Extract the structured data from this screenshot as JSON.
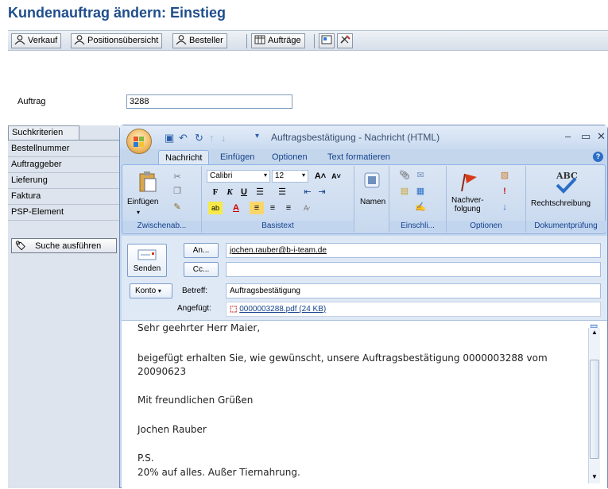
{
  "sap": {
    "title": "Kundenauftrag ändern: Einstieg",
    "toolbar": {
      "verkauf": "Verkauf",
      "positionsuebersicht": "Positionsübersicht",
      "besteller": "Besteller",
      "auftraege": "Aufträge"
    },
    "auftrag_label": "Auftrag",
    "auftrag_value": "3288",
    "left_panel": {
      "tab": "Suchkriterien",
      "items": [
        "Bestellnummer",
        "Auftraggeber",
        "Lieferung",
        "Faktura",
        "PSP-Element"
      ],
      "search_button": "Suche ausführen"
    }
  },
  "outlook": {
    "title": "Auftragsbestätigung - Nachricht (HTML)",
    "tabs": [
      "Nachricht",
      "Einfügen",
      "Optionen",
      "Text formatieren"
    ],
    "ribbon": {
      "einfuegen": "Einfügen",
      "font": "Calibri",
      "size": "12",
      "namen": "Namen",
      "nachverfolgung": "Nachver-\nfolgung",
      "rechtschreibung": "Rechtschreibung",
      "groups": [
        "Zwischenab...",
        "Basistext",
        "Einschli...",
        "Optionen",
        "Dokumentprüfung"
      ]
    },
    "header": {
      "senden": "Senden",
      "an_btn": "An...",
      "cc_btn": "Cc...",
      "to_value": "jochen.rauber@b-i-team.de",
      "cc_value": "",
      "konto": "Konto",
      "betreff_label": "Betreff:",
      "betreff_value": "Auftragsbestätigung",
      "angefuegt_label": "Angefügt:",
      "attachment": "0000003288.pdf (24 KB)"
    },
    "body": [
      "Sehr geehrter Herr Maier,",
      "beigefügt erhalten Sie, wie gewünscht, unsere Auftragsbestätigung 0000003288 vom",
      "20090623",
      "Mit freundlichen Grüßen",
      "Jochen Rauber",
      "P.S.",
      "20% auf alles. Außer Tiernahrung."
    ]
  }
}
